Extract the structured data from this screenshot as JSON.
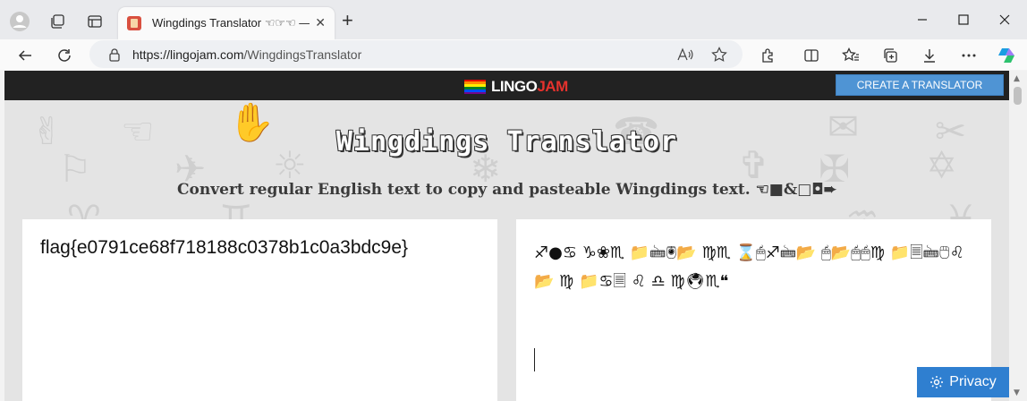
{
  "browser": {
    "tab_title": "Wingdings Translator ☜☞☜ — Li",
    "tab_close": "✕",
    "new_tab": "+",
    "url_host": "https://lingojam.com",
    "url_path": "/WingdingsTranslator"
  },
  "site": {
    "brand_a": "LINGO",
    "brand_b": "JAM",
    "create_button": "CREATE A TRANSLATOR",
    "page_title": "Wingdings Translator",
    "subtitle": "Convert regular English text to copy and pasteable Wingdings text. ☜■&□◘➨",
    "input_text": "flag{e0791ce68f718188c0378b1c0a3bdc9e}",
    "output_text": "♐●♋ ♑❀♏ 📁🖮🖲📂 ♍♏ ⌛🖱♐🖮📂 🖱📂🖱🖱♍ 📁🗏🖮🖱♌ 📂 ♍ 📁♋🗏 ♌ ♎ ♍🖲♏❝",
    "privacy_label": "Privacy"
  },
  "colors": {
    "accent_blue": "#4f94d4",
    "privacy_blue": "#2f7fd0",
    "brand_red": "#e5322d",
    "topbar": "#222222"
  },
  "icons": [
    "profile-icon",
    "workspaces-icon",
    "tab-actions-icon",
    "back-icon",
    "refresh-icon",
    "lock-icon",
    "read-aloud-icon",
    "favorite-star-icon",
    "extensions-icon",
    "split-screen-icon",
    "favorites-icon",
    "collections-icon",
    "downloads-icon",
    "more-icon",
    "copilot-icon",
    "gear-icon"
  ]
}
